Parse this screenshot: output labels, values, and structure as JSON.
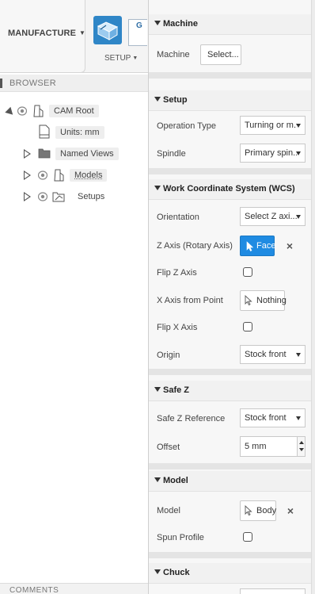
{
  "toolbar": {
    "workspace_label": "MANUFACTURE",
    "setup_label": "SETUP",
    "g_button_letter": "G"
  },
  "browser": {
    "header": "BROWSER",
    "tree": [
      {
        "label": "CAM Root",
        "expanded": true
      },
      {
        "label": "Units: mm"
      },
      {
        "label": "Named Views",
        "expanded": false
      },
      {
        "label": "Models",
        "expanded": false
      },
      {
        "label": "Setups",
        "expanded": false
      }
    ]
  },
  "comments": {
    "header": "COMMENTS"
  },
  "panel": {
    "machine": {
      "title": "Machine",
      "machine_label": "Machine",
      "machine_button": "Select..."
    },
    "setup": {
      "title": "Setup",
      "operation_type_label": "Operation Type",
      "operation_type_value": "Turning or m...",
      "spindle_label": "Spindle",
      "spindle_value": "Primary spin..."
    },
    "wcs": {
      "title": "Work Coordinate System (WCS)",
      "orientation_label": "Orientation",
      "orientation_value": "Select Z axi...",
      "z_axis_label": "Z Axis (Rotary Axis)",
      "z_axis_value": "Face",
      "flip_z_label": "Flip Z Axis",
      "flip_z_checked": false,
      "x_axis_label": "X Axis from Point",
      "x_axis_value": "Nothing",
      "flip_x_label": "Flip X Axis",
      "flip_x_checked": false,
      "origin_label": "Origin",
      "origin_value": "Stock front"
    },
    "safe_z": {
      "title": "Safe Z",
      "reference_label": "Safe Z Reference",
      "reference_value": "Stock front",
      "offset_label": "Offset",
      "offset_value": "5 mm"
    },
    "model": {
      "title": "Model",
      "model_label": "Model",
      "model_value": "Body",
      "spun_profile_label": "Spun Profile",
      "spun_profile_checked": false
    },
    "chuck": {
      "title": "Chuck"
    }
  },
  "colors": {
    "accent": "#1f8be2",
    "setup_icon": "#2f86c7"
  }
}
